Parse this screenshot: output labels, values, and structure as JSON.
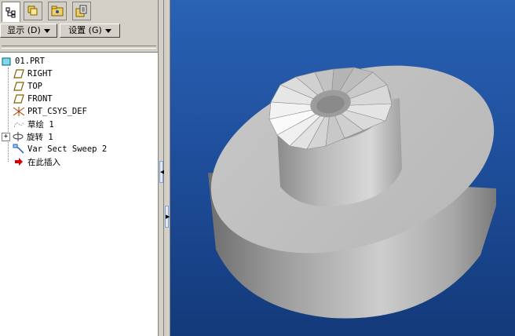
{
  "tabs": [
    {
      "icon": "model-tree-icon",
      "active": true
    },
    {
      "icon": "layers-icon",
      "active": false
    },
    {
      "icon": "folder-browser-icon",
      "active": false
    },
    {
      "icon": "favorites-icon",
      "active": false
    }
  ],
  "toolbar": {
    "show_label": "显示 (D)",
    "settings_label": "设置 (G)"
  },
  "tree": {
    "root": "01.PRT",
    "items": [
      {
        "label": "RIGHT",
        "icon": "datum-plane-icon"
      },
      {
        "label": "TOP",
        "icon": "datum-plane-icon"
      },
      {
        "label": "FRONT",
        "icon": "datum-plane-icon"
      },
      {
        "label": "PRT_CSYS_DEF",
        "icon": "coordinate-system-icon"
      },
      {
        "label": "草绘 1",
        "icon": "sketch-icon"
      },
      {
        "label": "旋转 1",
        "icon": "revolve-icon"
      },
      {
        "label": "Var Sect Sweep 2",
        "icon": "sweep-icon"
      },
      {
        "label": "在此插入",
        "icon": "insert-here-arrow-icon"
      }
    ]
  },
  "colors": {
    "viewport_top": "#2a62b4",
    "viewport_bottom": "#133a7a",
    "model_gray": "#c4c4c4",
    "insert_arrow": "#d40000"
  }
}
